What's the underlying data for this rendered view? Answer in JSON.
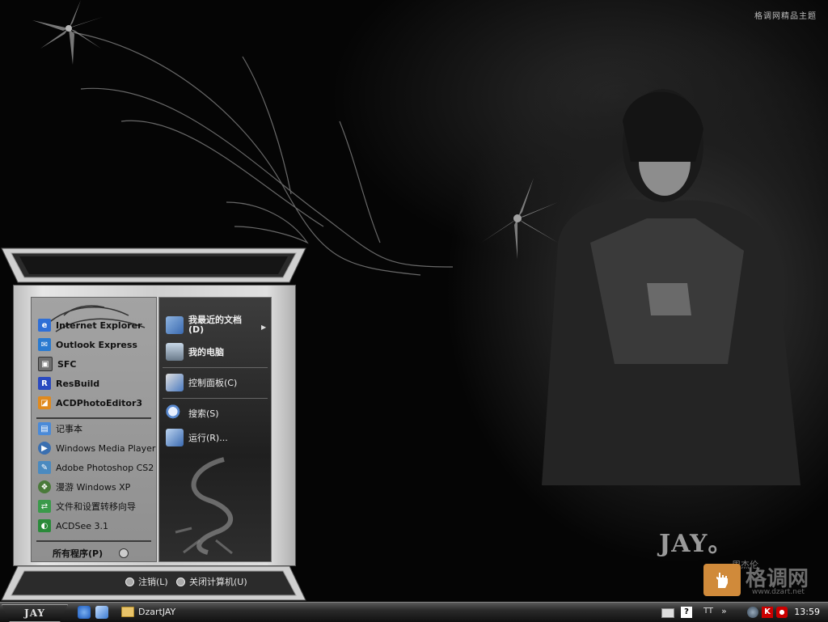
{
  "desktop": {
    "brand_top": "格调网精品主题",
    "jay_logo": "JAY。",
    "jay_sub": "周杰伦",
    "site_name": "格调网",
    "site_url": "www.dzart.net"
  },
  "start_menu": {
    "left_items": [
      {
        "label": "Internet Explorer",
        "icon": "ie-icon",
        "bold": true
      },
      {
        "label": "Outlook Express",
        "icon": "outlook-icon",
        "bold": true
      },
      {
        "label": "SFC",
        "icon": "sfc-icon",
        "bold": true
      },
      {
        "label": "ResBuild",
        "icon": "resbuild-icon",
        "bold": true
      },
      {
        "label": "ACDPhotoEditor3",
        "icon": "acdphotoeditor-icon",
        "bold": true
      },
      {
        "label": "记事本",
        "icon": "notepad-icon",
        "bold": false
      },
      {
        "label": "Windows Media Player",
        "icon": "media-player-icon",
        "bold": false
      },
      {
        "label": "Adobe Photoshop CS2",
        "icon": "photoshop-icon",
        "bold": false
      },
      {
        "label": "漫游 Windows XP",
        "icon": "tour-icon",
        "bold": false
      },
      {
        "label": "文件和设置转移向导",
        "icon": "transfer-wizard-icon",
        "bold": false
      },
      {
        "label": "ACDSee 3.1",
        "icon": "acdsee-icon",
        "bold": false
      }
    ],
    "all_programs": "所有程序(P)",
    "right_items": [
      {
        "label": "我最近的文档",
        "sub": "(D)",
        "icon": "recent-docs-icon"
      },
      {
        "label": "我的电脑",
        "icon": "my-computer-icon"
      },
      {
        "label": "控制面板(C)",
        "icon": "control-panel-icon"
      },
      {
        "label": "搜索(S)",
        "icon": "search-icon"
      },
      {
        "label": "运行(R)...",
        "icon": "run-icon"
      }
    ],
    "logoff": "注销(L)",
    "shutdown": "关闭计算机(U)"
  },
  "taskbar": {
    "start_label": "JAY",
    "task_label": "DzartJAY",
    "tray_text": "TT",
    "tray_chevron": "»",
    "clock": "13:59"
  },
  "colors": {
    "ie": "#2f6fd6",
    "outlook": "#2a7ad0",
    "acd": "#e08a1e",
    "accent_orange": "#d08a3a"
  }
}
